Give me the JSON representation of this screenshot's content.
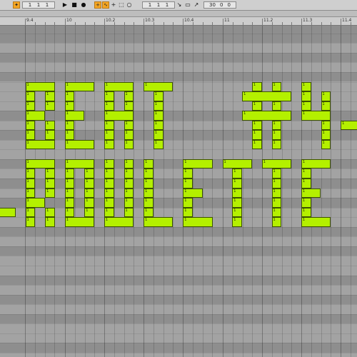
{
  "toolbar": {
    "arrangement_position": [
      "1",
      "1",
      "1"
    ],
    "loop_start": [
      "1",
      "1",
      "1"
    ],
    "loop_length": [
      "30",
      "0",
      "0"
    ],
    "icons": [
      "follow-icon",
      "play-icon",
      "stop-icon",
      "record-icon",
      "overdub-icon",
      "automation-icon",
      "draw-icon",
      "loop-icon",
      "punch-icon",
      "metronome-icon"
    ]
  },
  "ruler": {
    "ticks": [
      "9.4",
      "10",
      "10.2",
      "10.3",
      "10.4",
      "11",
      "11.2",
      "11.3",
      "11.4"
    ]
  },
  "note": {
    "velocity_label": "1",
    "color": "#b4f000"
  },
  "notes_text": "BEAT #4 - ROULETTE"
}
